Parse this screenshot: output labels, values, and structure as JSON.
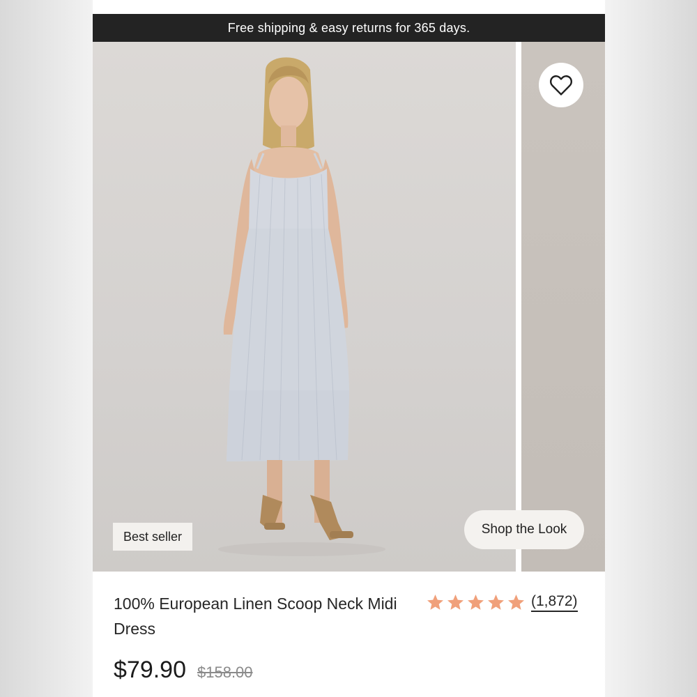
{
  "promo_banner": {
    "text": "Free shipping & easy returns for 365 days."
  },
  "gallery": {
    "badge": "Best seller",
    "shop_the_look": "Shop the Look",
    "favorite_icon": "heart-outline-icon"
  },
  "product": {
    "title": "100% European Linen Scoop Neck Midi Dress",
    "price": "$79.90",
    "original_price": "$158.00",
    "rating": {
      "stars": 5,
      "max_stars": 5,
      "count_label": "(1,872)",
      "star_color": "#f0a07a"
    }
  },
  "colors": {
    "promo_bg": "#232323",
    "star": "#f0a07a"
  }
}
